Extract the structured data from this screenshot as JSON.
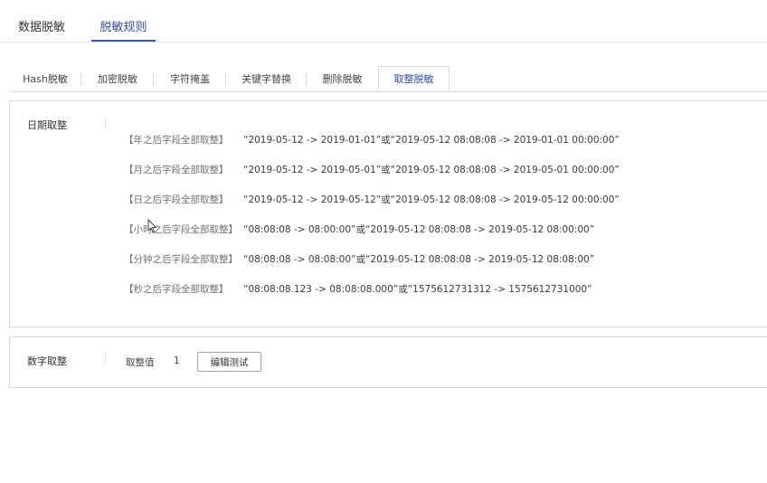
{
  "top_tabs": [
    {
      "label": "数据脱敏"
    },
    {
      "label": "脱敏规则",
      "active": true
    }
  ],
  "sub_tabs": [
    {
      "label": "Hash脱敏"
    },
    {
      "label": "加密脱敏"
    },
    {
      "label": "字符掩盖"
    },
    {
      "label": "关键字替换"
    },
    {
      "label": "删除脱敏"
    },
    {
      "label": "取整脱敏",
      "active": true
    }
  ],
  "date_round": {
    "title": "日期取整",
    "rules": [
      {
        "label": "【年之后字段全部取整】",
        "example": "“2019-05-12 -> 2019-01-01”或“2019-05-12 08:08:08 -> 2019-01-01 00:00:00”"
      },
      {
        "label": "【月之后字段全部取整】",
        "example": "“2019-05-12 -> 2019-05-01”或“2019-05-12 08:08:08 -> 2019-05-01 00:00:00”"
      },
      {
        "label": "【日之后字段全部取整】",
        "example": "“2019-05-12 -> 2019-05-12”或“2019-05-12 08:08:08 -> 2019-05-12 00:00:00”"
      },
      {
        "label": "【小时之后字段全部取整】",
        "example": "“08:08:08 -> 08:00:00”或“2019-05-12 08:08:08 -> 2019-05-12 08:00:00”"
      },
      {
        "label": "【分钟之后字段全部取整】",
        "example": "“08:08:08 -> 08:08:00”或“2019-05-12 08:08:08 -> 2019-05-12 08:08:00”"
      },
      {
        "label": "【秒之后字段全部取整】",
        "example": "“08:08:08.123 -> 08:08:08.000”或“1575612731312 -> 1575612731000”"
      }
    ]
  },
  "number_round": {
    "title": "数字取整",
    "value_label": "取整值",
    "value": "1",
    "edit_button": "编辑测试"
  },
  "colors": {
    "accent": "#3b5998",
    "border": "#d7d9de"
  }
}
